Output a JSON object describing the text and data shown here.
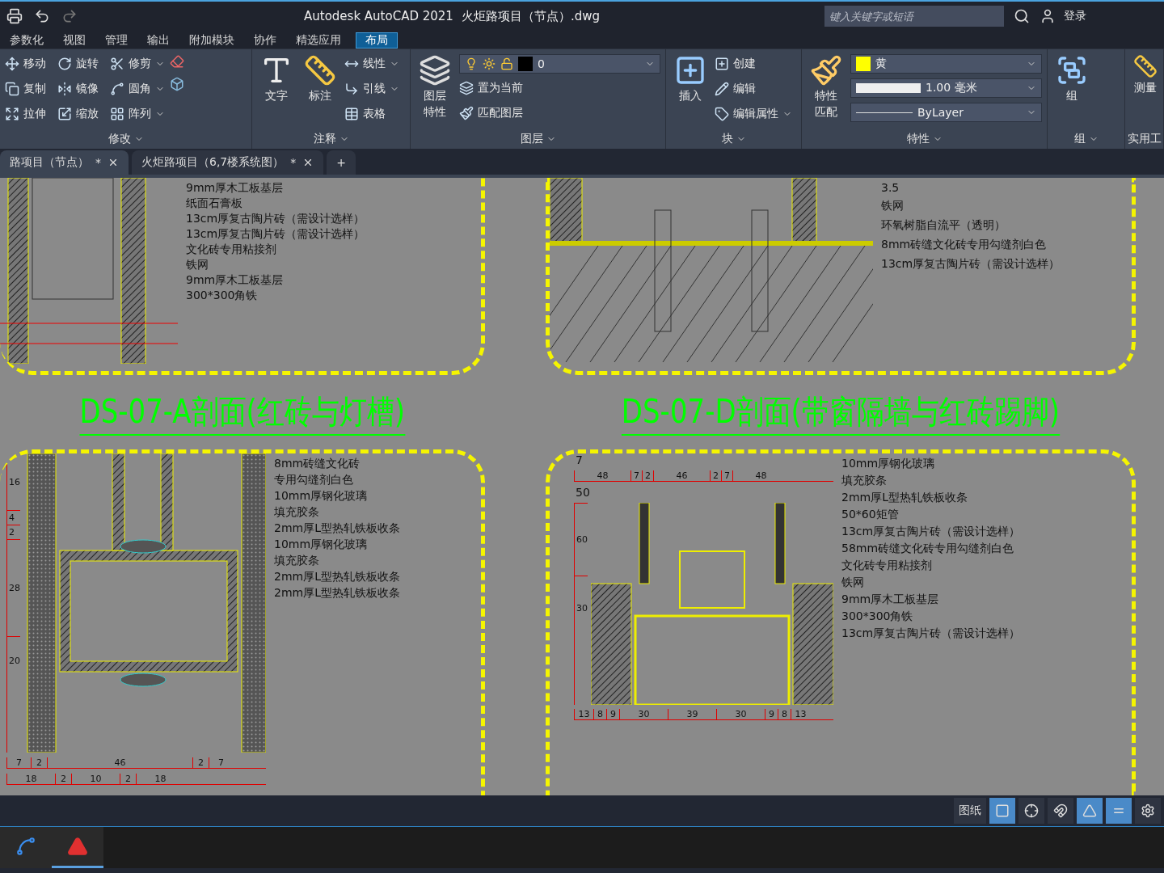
{
  "title_bar": {
    "app_title": "Autodesk AutoCAD 2021",
    "file_name": "火炬路项目（节点）.dwg",
    "search": {
      "placeholder": "键入关键字或短语"
    },
    "sign_in": "登录"
  },
  "menu_tabs": [
    {
      "label": "参数化",
      "selected": false
    },
    {
      "label": "视图",
      "selected": false
    },
    {
      "label": "管理",
      "selected": false
    },
    {
      "label": "输出",
      "selected": false
    },
    {
      "label": "附加模块",
      "selected": false
    },
    {
      "label": "协作",
      "selected": false
    },
    {
      "label": "精选应用",
      "selected": false
    },
    {
      "label": "布局",
      "selected": true
    }
  ],
  "modify_panel": {
    "title": "修改",
    "tools": [
      {
        "label": "移动",
        "kind": "move",
        "has_menu": false
      },
      {
        "label": "旋转",
        "kind": "rotate",
        "has_menu": false
      },
      {
        "label": "修剪",
        "kind": "trim",
        "has_menu": true
      },
      {
        "label": "复制",
        "kind": "copy",
        "has_menu": false
      },
      {
        "label": "镜像",
        "kind": "mirror",
        "has_menu": false
      },
      {
        "label": "圆角",
        "kind": "fillet",
        "has_menu": true
      },
      {
        "label": "拉伸",
        "kind": "stretch",
        "has_menu": false
      },
      {
        "label": "缩放",
        "kind": "scale",
        "has_menu": false
      },
      {
        "label": "阵列",
        "kind": "array",
        "has_menu": true
      }
    ]
  },
  "annotation_panel": {
    "title": "注释",
    "text_tool": "文字",
    "dimension_tool": "标注",
    "tools": [
      {
        "label": "线性",
        "kind": "linear",
        "has_menu": true
      },
      {
        "label": "引线",
        "kind": "leader",
        "has_menu": true
      },
      {
        "label": "表格",
        "kind": "table",
        "has_menu": false
      }
    ]
  },
  "layers_panel": {
    "title": "图层",
    "properties_tool": [
      "图层",
      "特性"
    ],
    "current_layer": "0",
    "tools": [
      {
        "label": "置为当前",
        "kind": "set-current"
      },
      {
        "label": "匹配图层",
        "kind": "match-layer"
      }
    ]
  },
  "block_panel": {
    "title": "块",
    "insert_tool": "插入",
    "tools": [
      {
        "label": "创建",
        "kind": "create",
        "has_menu": false
      },
      {
        "label": "编辑",
        "kind": "edit",
        "has_menu": false
      },
      {
        "label": "编辑属性",
        "kind": "attribute",
        "has_menu": true
      }
    ]
  },
  "properties_panel": {
    "title": "特性",
    "match_tool": [
      "特性",
      "匹配"
    ],
    "color": {
      "label": "黄"
    },
    "lineweight": "1.00 毫米",
    "linetype": "ByLayer"
  },
  "group_panel": {
    "title": "组",
    "group_tool": "组"
  },
  "utilities_panel": {
    "title": "实用工",
    "measure_tool": "测量"
  },
  "document_tabs": [
    {
      "label": "路项目（节点）",
      "modified": "*",
      "selected": true
    },
    {
      "label": "火炬路项目（6,7楼系统图）",
      "modified": "*",
      "selected": false
    }
  ],
  "new_tab": "+",
  "drawing": {
    "sections": [
      {
        "kind": "section_a",
        "labels": [
          "9mm厚木工板基层",
          "纸面石膏板",
          "13cm厚复古陶片砖（需设计选样）",
          "13cm厚复古陶片砖（需设计选样）",
          "文化砖专用粘接剂",
          "铁网",
          "9mm厚木工板基层",
          "300*300角铁"
        ],
        "title": "DS-07-A剖面(红砖与灯槽)"
      },
      {
        "kind": "section_d",
        "dimension": "3.5",
        "labels": [
          "铁网",
          "环氧树脂自流平（透明）",
          "8mm砖缝文化砖专用勾缝剂白色",
          "13cm厚复古陶片砖（需设计选样）"
        ],
        "title": "DS-07-D剖面(带窗隔墙与红砖踢脚)"
      },
      {
        "kind": "glass_joint",
        "vertical_dims": [
          "16",
          "4",
          "2",
          "28",
          "20"
        ],
        "middle_dims": [
          "7",
          "2",
          "46",
          "2",
          "7"
        ],
        "bottom_dims": [
          "18",
          "2",
          "10",
          "2",
          "18"
        ],
        "labels": [
          "8mm砖缝文化砖",
          "专用勾缝剂白色",
          "10mm厚钢化玻璃",
          "填充胶条",
          "2mm厚L型热轧铁板收条",
          "10mm厚钢化玻璃",
          "填充胶条",
          "2mm厚L型热轧铁板收条",
          "2mm厚L型热轧铁板收条"
        ]
      },
      {
        "kind": "window_frame",
        "top_dim": "7",
        "upper_dims": [
          "48",
          "7",
          "2",
          "46",
          "2",
          "7",
          "48"
        ],
        "tube_dim": "50",
        "vertical_dims": [
          "60",
          "30"
        ],
        "bottom_dims": [
          "13",
          "8",
          "9",
          "30",
          "39",
          "30",
          "9",
          "8",
          "13"
        ],
        "labels": [
          "10mm厚钢化玻璃",
          "填充胶条",
          "2mm厚L型热轧铁板收条",
          "50*60矩管",
          "13cm厚复古陶片砖（需设计选样）",
          "58mm砖缝文化砖专用勾缝剂白色",
          "文化砖专用粘接剂",
          "铁网",
          "9mm厚木工板基层",
          "300*300角铁",
          "13cm厚复古陶片砖（需设计选样）"
        ]
      }
    ]
  },
  "status_bar": {
    "space": "图纸",
    "toggles": [
      {
        "kind": "ortho",
        "on": true
      },
      {
        "kind": "polar",
        "on": false
      },
      {
        "kind": "snap",
        "on": false
      },
      {
        "kind": "isometric",
        "on": true
      },
      {
        "kind": "lineweight",
        "on": true
      }
    ]
  }
}
